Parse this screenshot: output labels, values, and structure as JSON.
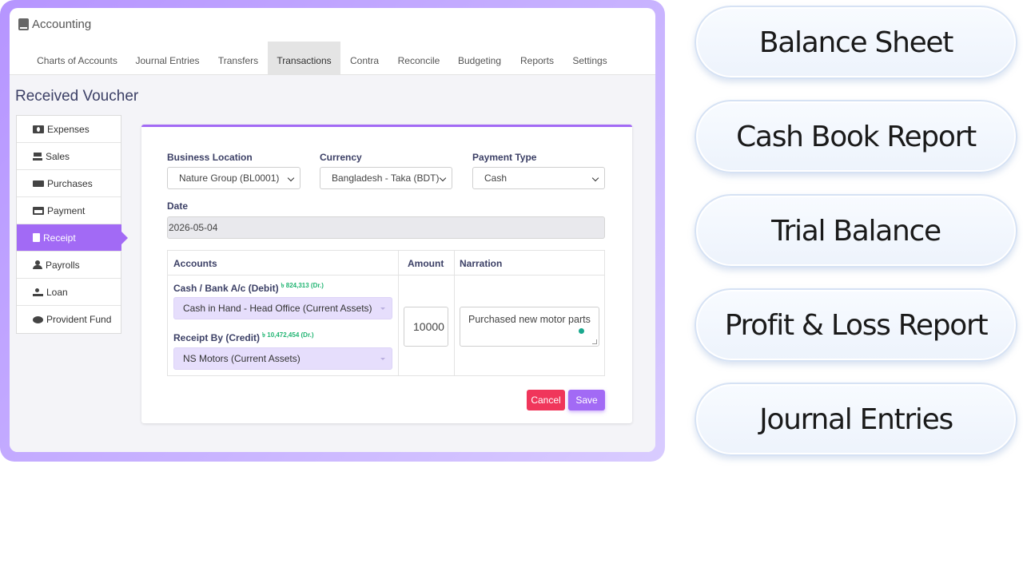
{
  "app": {
    "title": "Accounting"
  },
  "nav": {
    "tabs": [
      "Charts of Accounts",
      "Journal Entries",
      "Transfers",
      "Transactions",
      "Contra",
      "Reconcile",
      "Budgeting",
      "Reports",
      "Settings"
    ],
    "active": "Transactions"
  },
  "page": {
    "title": "Received Voucher"
  },
  "sidebar": {
    "items": [
      {
        "label": "Expenses",
        "icon": "money-icon"
      },
      {
        "label": "Sales",
        "icon": "cart-icon"
      },
      {
        "label": "Purchases",
        "icon": "truck-icon"
      },
      {
        "label": "Payment",
        "icon": "credit-card-icon"
      },
      {
        "label": "Receipt",
        "icon": "receipt-icon",
        "active": true
      },
      {
        "label": "Payrolls",
        "icon": "user-check-icon"
      },
      {
        "label": "Loan",
        "icon": "hand-coin-icon"
      },
      {
        "label": "Provident Fund",
        "icon": "piggy-bank-icon"
      }
    ]
  },
  "form": {
    "business_location": {
      "label": "Business Location",
      "value": "Nature Group (BL0001)"
    },
    "currency": {
      "label": "Currency",
      "value": "Bangladesh - Taka (BDT)"
    },
    "payment_type": {
      "label": "Payment Type",
      "value": "Cash"
    },
    "date": {
      "label": "Date",
      "value": "2026-05-04"
    },
    "table": {
      "headers": {
        "accounts": "Accounts",
        "amount": "Amount",
        "narration": "Narration"
      },
      "debit": {
        "label": "Cash / Bank A/c (Debit)",
        "balance": "৳ 824,313 (Dr.)",
        "value": "Cash in Hand - Head Office (Current Assets)"
      },
      "credit": {
        "label": "Receipt By (Credit)",
        "balance": "৳ 10,472,454 (Dr.)",
        "value": "NS Motors (Current Assets)"
      },
      "amount": "10000",
      "narration": "Purchased new motor parts"
    },
    "buttons": {
      "cancel": "Cancel",
      "save": "Save"
    }
  },
  "reports": [
    "Balance Sheet",
    "Cash Book Report",
    "Trial Balance",
    "Profit & Loss Report",
    "Journal Entries"
  ],
  "colors": {
    "accent": "#a26af5",
    "danger": "#f0365b",
    "balance_green": "#22b573"
  }
}
